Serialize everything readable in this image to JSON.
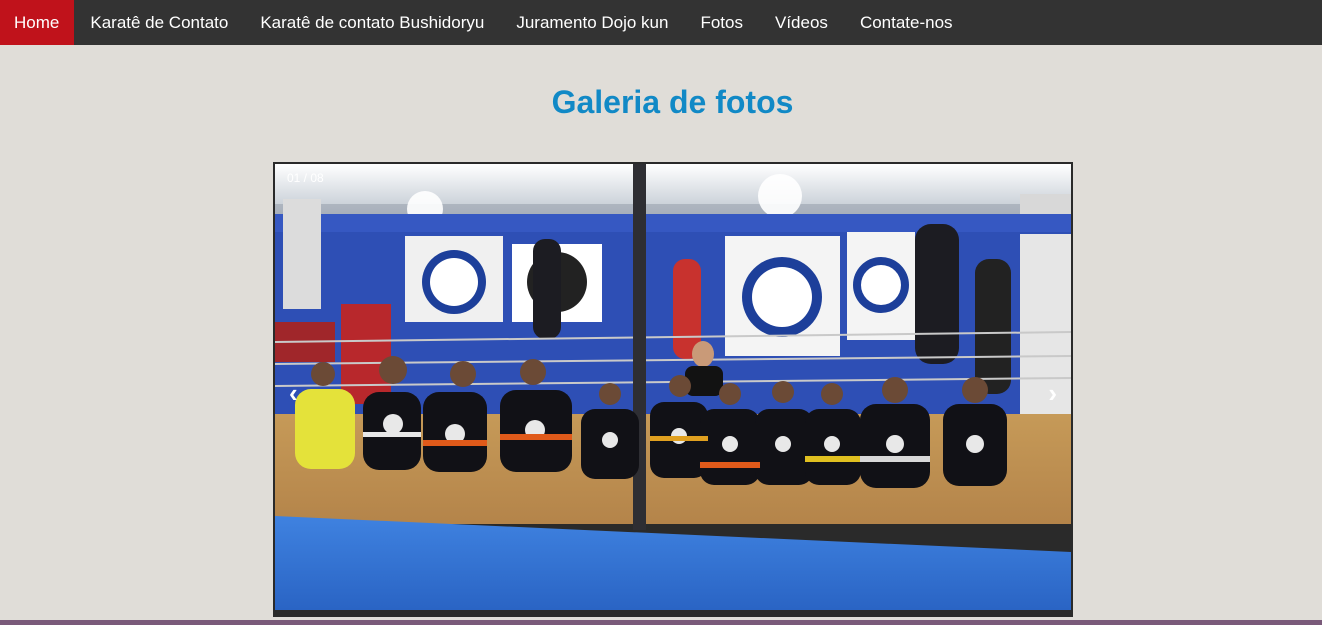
{
  "nav": {
    "items": [
      {
        "label": "Home",
        "active": true
      },
      {
        "label": "Karatê de Contato"
      },
      {
        "label": "Karatê de contato Bushidoryu"
      },
      {
        "label": "Juramento Dojo kun"
      },
      {
        "label": "Fotos"
      },
      {
        "label": "Vídeos"
      },
      {
        "label": "Contate-nos"
      }
    ]
  },
  "main": {
    "title": "Galeria de fotos"
  },
  "slideshow": {
    "counter": "01 / 08",
    "prev_label": "‹",
    "next_label": "›"
  },
  "colors": {
    "nav_bg": "#333333",
    "nav_active": "#c0121b",
    "title": "#1189c6",
    "page_bg": "#e0ddd8"
  }
}
